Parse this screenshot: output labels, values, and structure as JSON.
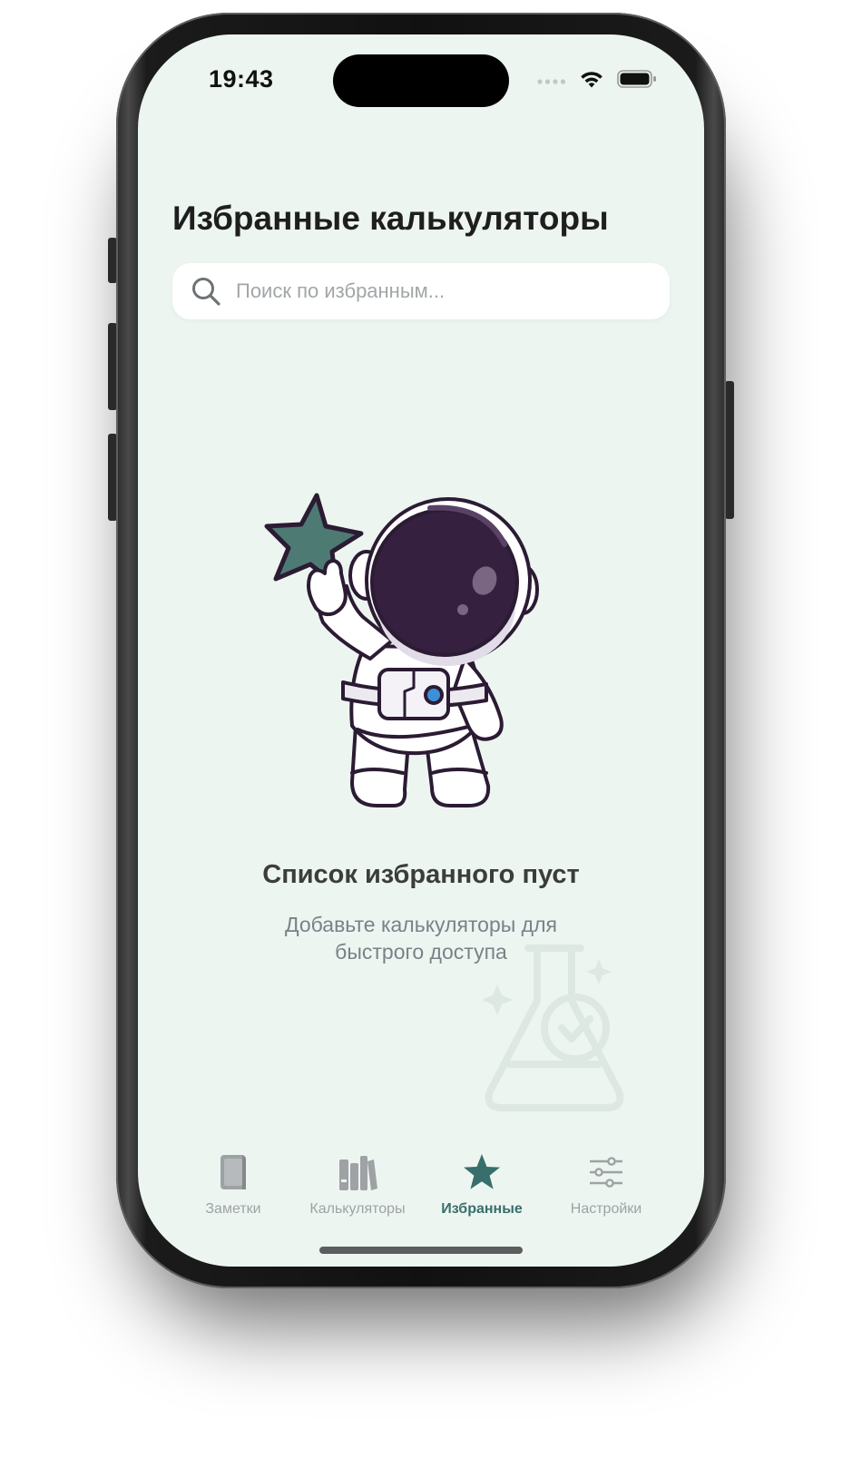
{
  "status_bar": {
    "time": "19:43",
    "icons": [
      "cellular-dots-icon",
      "wifi-icon",
      "battery-icon"
    ]
  },
  "page": {
    "title": "Избранные калькуляторы"
  },
  "search": {
    "placeholder": "Поиск по избранным...",
    "value": "",
    "icon": "search-icon"
  },
  "empty_state": {
    "illustration": "astronaut-holding-star",
    "title": "Список избранного пуст",
    "subtitle": "Добавьте калькуляторы для быстрого доступа",
    "background_icon": "flask-check-icon"
  },
  "tabbar": {
    "tabs": [
      {
        "label": "Заметки",
        "icon": "notebook-icon",
        "active": false
      },
      {
        "label": "Калькуляторы",
        "icon": "library-books-icon",
        "active": false
      },
      {
        "label": "Избранные",
        "icon": "star-icon",
        "active": true
      },
      {
        "label": "Настройки",
        "icon": "sliders-icon",
        "active": false
      }
    ]
  },
  "colors": {
    "screen_background": "#edf5f0",
    "accent": "#386e6b",
    "tab_inactive": "#9ea2a5",
    "star_fill": "#4e7a74",
    "helmet_visor": "#35203f"
  }
}
